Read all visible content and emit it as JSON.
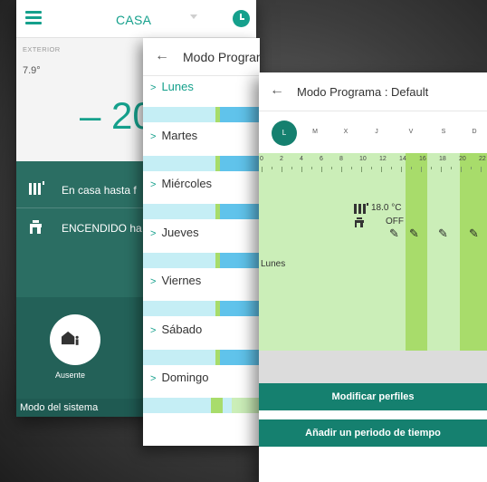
{
  "colors": {
    "accent": "#15a08c",
    "dark_teal": "#2b6e63",
    "button_teal": "#15806f",
    "schedule_light_blue": "#c5eef5",
    "schedule_blue": "#60c3eb",
    "schedule_light_green": "#cbeeb8",
    "schedule_green": "#a8dc6b"
  },
  "home": {
    "menu_icon": "hamburger-icon",
    "title": "CASA",
    "clock_icon": "clock-icon",
    "exterior_label": "EXTERIOR",
    "exterior_temp": "7.9°",
    "room_temp": "– 20",
    "status": [
      {
        "icon": "radiator-icon",
        "text": "En casa hasta f"
      },
      {
        "icon": "tap-icon",
        "text": "ENCENDIDO ha"
      }
    ],
    "away_label": "Ausente",
    "system_mode": "Modo del sistema"
  },
  "week": {
    "title": "Modo Programa : Progra...",
    "days": [
      {
        "label": "Lunes",
        "active": true
      },
      {
        "label": "Martes",
        "active": false
      },
      {
        "label": "Miércoles",
        "active": false
      },
      {
        "label": "Jueves",
        "active": false
      },
      {
        "label": "Viernes",
        "active": false
      },
      {
        "label": "Sábado",
        "active": false
      },
      {
        "label": "Domingo",
        "active": false
      }
    ]
  },
  "detail": {
    "title": "Modo Programa : Default",
    "weekdays": [
      "L",
      "M",
      "X",
      "J",
      "V",
      "S",
      "D"
    ],
    "selected_day": "L",
    "hours": [
      "0",
      "2",
      "4",
      "6",
      "8",
      "10",
      "12",
      "14",
      "16",
      "18",
      "20",
      "22"
    ],
    "day_label": "Lunes",
    "heating_setpoint": "18.0 °C",
    "dhw_state": "OFF",
    "btn_edit_profiles": "Modificar perfiles",
    "btn_add_period": "Añadir un periodo de tiempo"
  }
}
